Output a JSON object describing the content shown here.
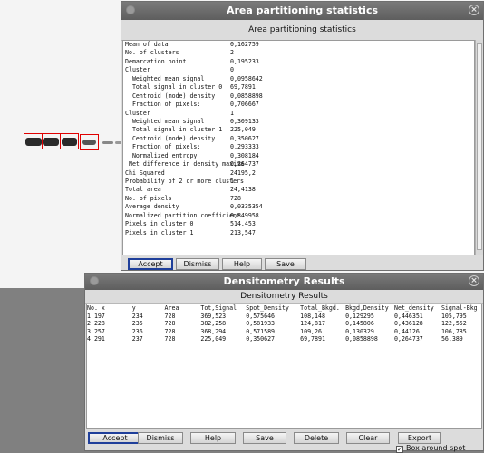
{
  "stats_window": {
    "title": "Area partitioning statistics",
    "subtitle": "Area partitioning statistics",
    "rows": [
      {
        "k": "Mean of data",
        "v": "0,162759"
      },
      {
        "k": "No. of clusters",
        "v": "2"
      },
      {
        "k": "Demarcation point",
        "v": "0,195233"
      },
      {
        "k": "Cluster",
        "v": "0"
      },
      {
        "k": "  Weighted mean signal",
        "v": "0,0958642"
      },
      {
        "k": "  Total signal in cluster 0",
        "v": "69,7891"
      },
      {
        "k": "  Centroid (mode) density",
        "v": "0,0858898"
      },
      {
        "k": "  Fraction of pixels:",
        "v": "0,706667"
      },
      {
        "k": "Cluster",
        "v": "1"
      },
      {
        "k": "  Weighted mean signal",
        "v": "0,309133"
      },
      {
        "k": "  Total signal in cluster 1",
        "v": "225,049"
      },
      {
        "k": "  Centroid (mode) density",
        "v": "0,350627"
      },
      {
        "k": "  Fraction of pixels:",
        "v": "0,293333"
      },
      {
        "k": "  Normalized entropy",
        "v": "0,308184"
      },
      {
        "k": " Net difference in density maxima",
        "v": "0,264737"
      },
      {
        "k": "Chi Squared",
        "v": "24195,2"
      },
      {
        "k": "Probability of 2 or more clusters",
        "v": "1"
      },
      {
        "k": "Total area",
        "v": "24,4138"
      },
      {
        "k": "No. of pixels",
        "v": "728"
      },
      {
        "k": "Average density",
        "v": "0,0335354"
      },
      {
        "k": "Normalized partition coefficient",
        "v": "0,849958"
      },
      {
        "k": "Pixels in cluster 0",
        "v": "514,453"
      },
      {
        "k": "Pixels in cluster 1",
        "v": "213,547"
      }
    ],
    "buttons": {
      "accept": "Accept",
      "dismiss": "Dismiss",
      "help": "Help",
      "save": "Save"
    }
  },
  "results_window": {
    "title": "Densitometry Results",
    "subtitle": "Densitometry Results",
    "headers": [
      "No. x",
      "y",
      "Area",
      "Tot,Signal",
      "Spot_Density",
      "Total_Bkgd.",
      "Bkgd,Density",
      "Net_density",
      "Signal-Bkg"
    ],
    "rows": [
      [
        "1  197",
        "234",
        "728",
        "369,523",
        "0,575646",
        "108,148",
        "0,129295",
        "0,446351",
        "105,795"
      ],
      [
        "2  228",
        "235",
        "728",
        "382,258",
        "0,581933",
        "124,817",
        "0,145806",
        "0,436128",
        "122,552"
      ],
      [
        "3  257",
        "236",
        "728",
        "368,294",
        "0,571589",
        "109,26",
        "0,130329",
        "0,44126",
        "106,785"
      ],
      [
        "4  291",
        "237",
        "728",
        "225,049",
        "0,350627",
        "69,7891",
        "0,0858898",
        "0,264737",
        "56,389"
      ]
    ],
    "buttons": {
      "accept": "Accept",
      "dismiss": "Dismiss",
      "help": "Help",
      "save": "Save",
      "delete": "Delete",
      "clear": "Clear",
      "export": "Export"
    }
  },
  "background": {
    "checkbox_label": "Box around spot"
  }
}
